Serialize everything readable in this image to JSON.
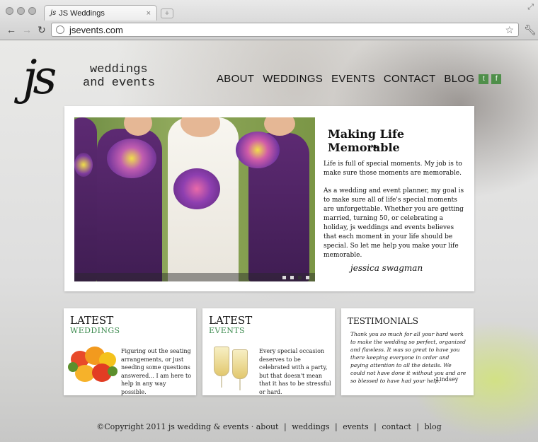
{
  "browser": {
    "tab_title": "JS Weddings",
    "tab_favicon": "js",
    "tab_close": "×",
    "new_tab": "+",
    "url": "jsevents.com"
  },
  "logo": {
    "mark": "js",
    "line1": "weddings",
    "line2": "and events"
  },
  "menu": {
    "about": "ABOUT",
    "weddings": "WEDDINGS",
    "events": "EVENTS",
    "contact": "CONTACT",
    "blog": "BLOG"
  },
  "hero": {
    "title": "Making Life Memorable",
    "flourish": "❧",
    "p1": "Life is full of special moments. My job is to make sure those moments are memorable.",
    "p2": "As a wedding and event planner, my goal is to make sure all of life's special moments are unforgettable. Whether you are getting married, turning 50, or celebrating a holiday, js weddings and events believes that each moment in your life should be special. So let me help you make your life memorable.",
    "signature": "jessica swagman"
  },
  "latest_weddings": {
    "title": "LATEST",
    "subtitle": "WEDDINGS",
    "text": "Figuring out the seating arrangements, or just needing some questions answered... I am here to help in any way possible."
  },
  "latest_events": {
    "title": "LATEST",
    "subtitle": "EVENTS",
    "text": "Every special occasion deserves to be celebrated with a party, but that doesn't mean that it has to be stressful or hard."
  },
  "testimonials": {
    "title": "TESTIMONIALS",
    "quote": "Thank you so much for all your hard work to make the wedding so perfect, organized and flawless. It was so great to have you there keeping everyone in order and paying attention to all the details. We could not have done it without you and are so blessed to have had your help.",
    "author": "-Lindsey"
  },
  "footer": {
    "copyright": "©Copyright 2011 js wedding & events ·",
    "links": [
      "about",
      "weddings",
      "events",
      "contact",
      "blog"
    ],
    "separator": "|"
  },
  "colors": {
    "accent_green": "#3e8c50",
    "dress_purple": "#4f2563"
  }
}
